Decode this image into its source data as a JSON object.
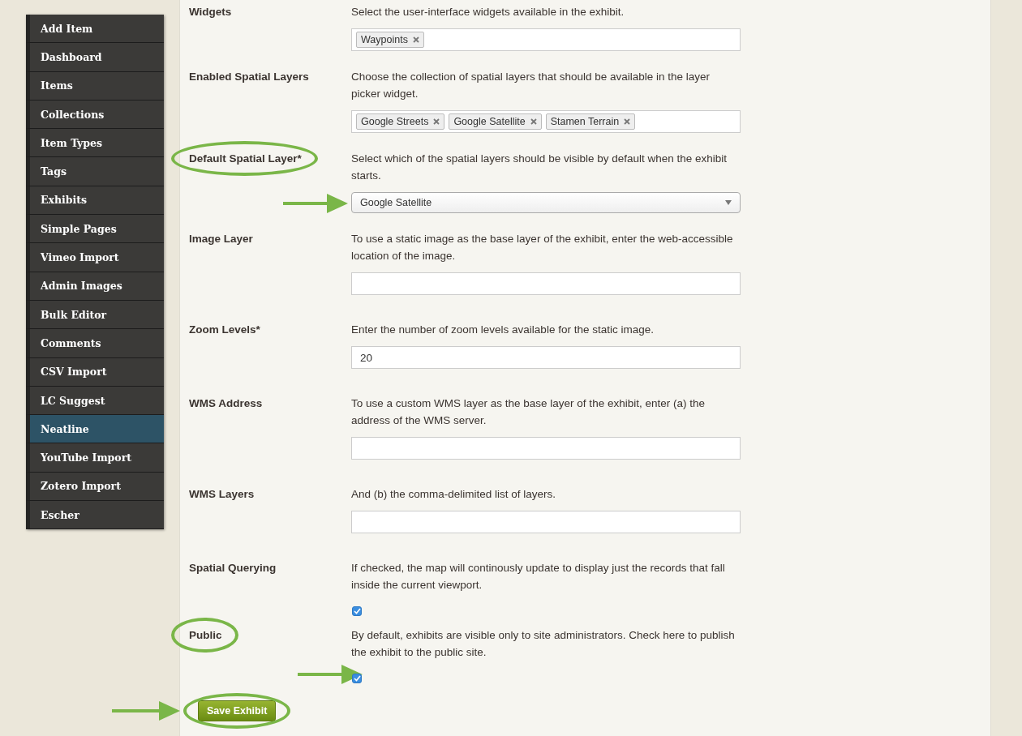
{
  "sidebar": {
    "items": [
      {
        "label": "Add Item",
        "selected": false
      },
      {
        "label": "Dashboard",
        "selected": false
      },
      {
        "label": "Items",
        "selected": false
      },
      {
        "label": "Collections",
        "selected": false
      },
      {
        "label": "Item Types",
        "selected": false
      },
      {
        "label": "Tags",
        "selected": false
      },
      {
        "label": "Exhibits",
        "selected": false
      },
      {
        "label": "Simple Pages",
        "selected": false
      },
      {
        "label": "Vimeo Import",
        "selected": false
      },
      {
        "label": "Admin Images",
        "selected": false
      },
      {
        "label": "Bulk Editor",
        "selected": false
      },
      {
        "label": "Comments",
        "selected": false
      },
      {
        "label": "CSV Import",
        "selected": false
      },
      {
        "label": "LC Suggest",
        "selected": false
      },
      {
        "label": "Neatline",
        "selected": true
      },
      {
        "label": "YouTube Import",
        "selected": false
      },
      {
        "label": "Zotero Import",
        "selected": false
      },
      {
        "label": "Escher",
        "selected": false
      }
    ]
  },
  "form": {
    "fields": [
      {
        "kind": "tags",
        "label": "Widgets",
        "description": "Select the user-interface widgets available in the exhibit.",
        "tags": [
          "Waypoints"
        ],
        "circled": false,
        "arrow": false
      },
      {
        "kind": "tags",
        "label": "Enabled Spatial Layers",
        "description": "Choose the collection of spatial layers that should be available in the layer picker widget.",
        "tags": [
          "Google Streets",
          "Google Satellite",
          "Stamen Terrain"
        ],
        "circled": false,
        "arrow": false
      },
      {
        "kind": "select",
        "label": "Default Spatial Layer*",
        "description": "Select which of the spatial layers should be visible by default when the exhibit starts.",
        "value": "Google Satellite",
        "circled": true,
        "arrow": true
      },
      {
        "kind": "text",
        "label": "Image Layer",
        "description": "To use a static image as the base layer of the exhibit, enter the web-accessible location of the image.",
        "circled": false,
        "arrow": false
      },
      {
        "kind": "text",
        "label": "Zoom Levels*",
        "description": "Enter the number of zoom levels available for the static image.",
        "value": "20",
        "circled": false,
        "arrow": false
      },
      {
        "kind": "text",
        "label": "WMS Address",
        "description": "To use a custom WMS layer as the base layer of the exhibit, enter (a) the address of the WMS server.",
        "circled": false,
        "arrow": false
      },
      {
        "kind": "text",
        "label": "WMS Layers",
        "description": "And (b) the comma-delimited list of layers.",
        "circled": false,
        "arrow": false
      },
      {
        "kind": "checkbox",
        "label": "Spatial Querying",
        "description": "If checked, the map will continously update to display just the records that fall inside the current viewport.",
        "checked": true,
        "circled": false,
        "arrow": false
      },
      {
        "kind": "checkbox",
        "label": "Public",
        "description": "By default, exhibits are visible only to site administrators. Check here to publish the exhibit to the public site.",
        "checked": true,
        "circled": true,
        "arrow": true
      }
    ],
    "save_button": {
      "label": "Save Exhibit",
      "circled": true,
      "arrow": true
    }
  }
}
